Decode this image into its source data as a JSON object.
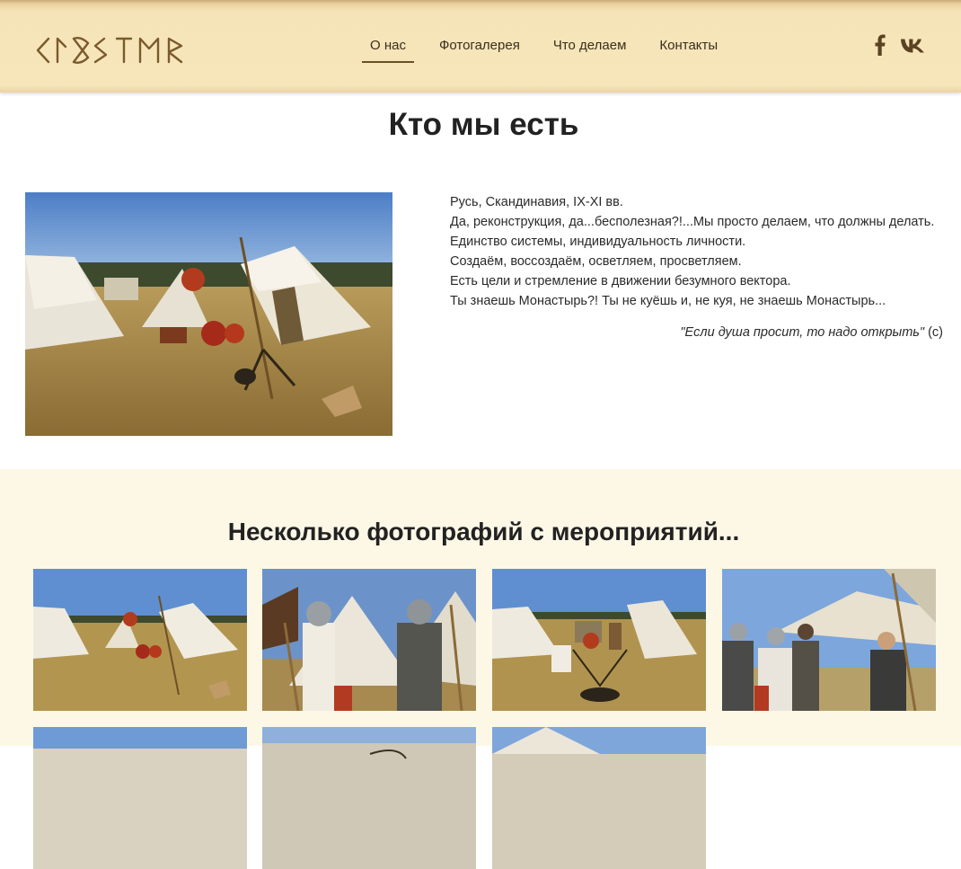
{
  "header": {
    "logo_text": "ᚲᛚᚱᛊᛏᛗᚱ",
    "nav": [
      {
        "label": "О нас",
        "active": true
      },
      {
        "label": "Фотогалерея",
        "active": false
      },
      {
        "label": "Что делаем",
        "active": false
      },
      {
        "label": "Контакты",
        "active": false
      }
    ],
    "social": [
      "facebook-icon",
      "vk-icon"
    ]
  },
  "about": {
    "title": "Кто мы есть",
    "lines": [
      "Русь, Скандинавия, IX-XI вв.",
      "Да, реконструкция, да...бесполезная?!...Мы просто делаем, что должны делать.",
      "Единство системы, индивидуальность личности.",
      "Создаём, воссоздаём, осветляем, просветляем.",
      "Есть цели и стремление в движении безумного вектора.",
      "Ты знаешь Монастырь?! Ты не куёшь и, не куя, не знаешь Монастырь..."
    ],
    "quote": "\"Если душа просит, то надо открыть\"",
    "quote_suffix": " (c)"
  },
  "gallery": {
    "title": "Несколько фотографий с мероприятий..."
  },
  "colors": {
    "header_bg": "#f6e6ba",
    "accent_brown": "#6b5226",
    "gallery_bg": "#fdf8e6"
  }
}
